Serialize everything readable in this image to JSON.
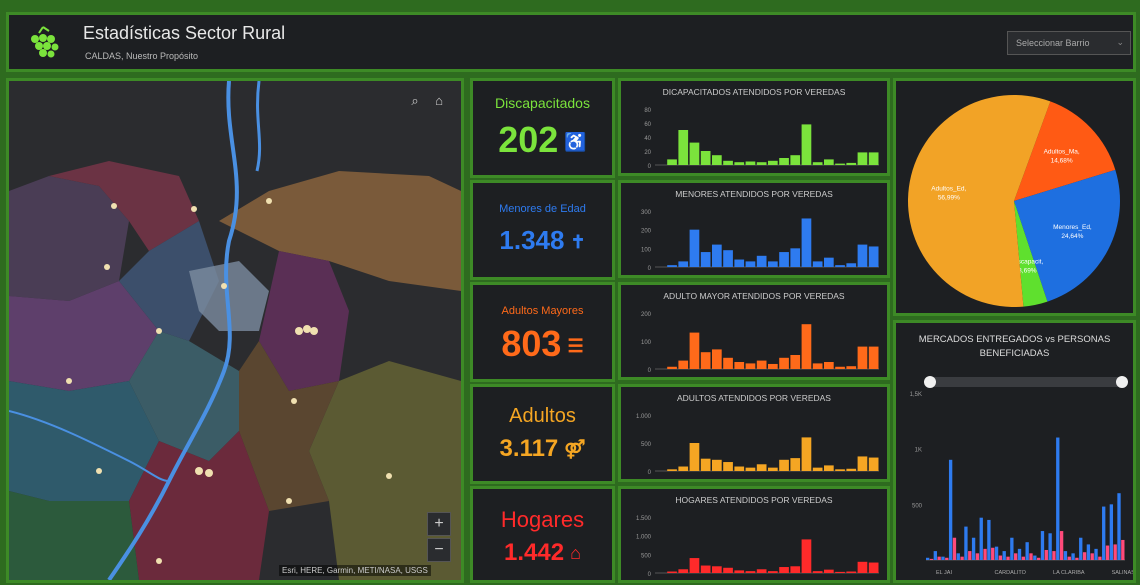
{
  "header": {
    "title": "Estadísticas Sector Rural",
    "subtitle": "CALDAS, Nuestro Propósito",
    "select_placeholder": "Seleccionar Barrio"
  },
  "map": {
    "attribution": "Esri, HERE, Garmin, METI/NASA, USGS"
  },
  "kpis": [
    {
      "label": "Discapacitados",
      "value": "202",
      "icon": "wheelchair-icon",
      "color": "#7be33c"
    },
    {
      "label": "Menores de Edad",
      "value": "1.348",
      "icon": "child-icon",
      "color": "#2e7bf0"
    },
    {
      "label": "Adultos Mayores",
      "value": "803",
      "icon": "elderly-icon",
      "color": "#ff6a1a"
    },
    {
      "label": "Adultos",
      "value": "3.117",
      "icon": "adults-icon",
      "color": "#f5a623"
    },
    {
      "label": "Hogares",
      "value": "1.442",
      "icon": "home-icon",
      "color": "#ff2a2a"
    }
  ],
  "chart_data": [
    {
      "type": "bar",
      "title": "DICAPACITADOS ATENDIDOS POR VEREDAS",
      "color": "#7be33c",
      "ylim": [
        0,
        80
      ],
      "yticks": [
        "80",
        "60",
        "40",
        "20",
        "0"
      ],
      "values": [
        0,
        8,
        50,
        32,
        20,
        14,
        6,
        4,
        5,
        4,
        6,
        10,
        14,
        58,
        4,
        8,
        2,
        3,
        18,
        18
      ]
    },
    {
      "type": "bar",
      "title": "MENORES ATENDIDOS POR VEREDAS",
      "color": "#2e7bf0",
      "ylim": [
        0,
        300
      ],
      "yticks": [
        "300",
        "200",
        "100",
        "0"
      ],
      "values": [
        0,
        10,
        30,
        200,
        80,
        120,
        90,
        40,
        30,
        60,
        30,
        80,
        100,
        260,
        30,
        50,
        10,
        20,
        120,
        110
      ]
    },
    {
      "type": "bar",
      "title": "ADULTO MAYOR ATENDIDOS POR VEREDAS",
      "color": "#ff6a1a",
      "ylim": [
        0,
        200
      ],
      "yticks": [
        "200",
        "100",
        "0"
      ],
      "values": [
        0,
        8,
        30,
        130,
        60,
        70,
        40,
        25,
        20,
        30,
        18,
        40,
        50,
        160,
        20,
        25,
        8,
        10,
        80,
        80
      ]
    },
    {
      "type": "bar",
      "title": "ADULTOS ATENDIDOS POR VEREDAS",
      "color": "#f5a623",
      "ylim": [
        0,
        1000
      ],
      "yticks": [
        "1.000",
        "500",
        "0"
      ],
      "values": [
        0,
        30,
        80,
        500,
        220,
        200,
        160,
        80,
        60,
        120,
        60,
        200,
        230,
        600,
        60,
        100,
        30,
        40,
        260,
        240
      ]
    },
    {
      "type": "bar",
      "title": "HOGARES ATENDIDOS POR VEREDAS",
      "color": "#ff2a2a",
      "ylim": [
        0,
        1500
      ],
      "yticks": [
        "1.500",
        "1.000",
        "500",
        "0"
      ],
      "values": [
        0,
        40,
        100,
        400,
        200,
        180,
        140,
        70,
        50,
        100,
        50,
        160,
        180,
        900,
        50,
        90,
        30,
        40,
        300,
        280
      ]
    },
    {
      "type": "pie",
      "labels": [
        "Adultos_Ma",
        "Menores_Ed",
        "Discapacit",
        "Adultos_Ed"
      ],
      "percent_labels": [
        "14,68%",
        "24,64%",
        "3,69%",
        "56,99%"
      ],
      "values": [
        14.68,
        24.64,
        3.69,
        56.99
      ],
      "colors": [
        "#ff5a14",
        "#1e6fe0",
        "#5fe02e",
        "#f2a326"
      ]
    },
    {
      "type": "bar",
      "title": "MERCADOS ENTREGADOS vs PERSONAS BENEFICIADAS",
      "ytick_labels": [
        "1,5K",
        "1K",
        "500"
      ],
      "xtick_labels": [
        "EL JAI",
        "CARDALITO",
        "LA CLARIBA",
        "SALINAS"
      ],
      "series": [
        {
          "color": "#2e7bf0",
          "values": [
            20,
            80,
            30,
            900,
            60,
            300,
            200,
            380,
            360,
            120,
            80,
            200,
            100,
            160,
            40,
            260,
            240,
            1100,
            80,
            60,
            200,
            140,
            100,
            480,
            500,
            600
          ]
        },
        {
          "color": "#ff4a7a",
          "values": [
            10,
            30,
            20,
            200,
            30,
            80,
            60,
            100,
            110,
            40,
            30,
            60,
            30,
            60,
            20,
            90,
            80,
            260,
            30,
            20,
            70,
            60,
            30,
            130,
            140,
            180
          ]
        }
      ]
    }
  ]
}
